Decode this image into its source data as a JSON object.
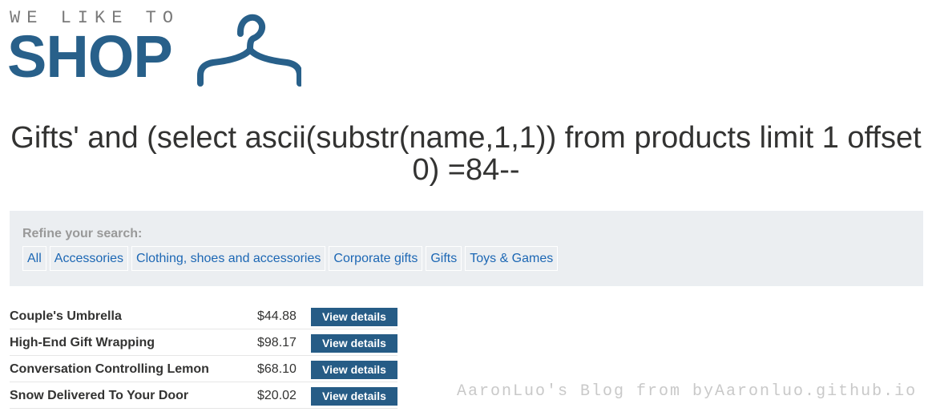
{
  "logo": {
    "tagline": "WE LIKE TO",
    "word": "SHOP",
    "icon": "hanger-icon",
    "color": "#28608a"
  },
  "page_title": "Gifts' and (select ascii(substr(name,1,1)) from products limit 1 offset 0) =84--",
  "filters": {
    "heading": "Refine your search:",
    "items": [
      {
        "label": "All"
      },
      {
        "label": "Accessories"
      },
      {
        "label": "Clothing, shoes and accessories"
      },
      {
        "label": "Corporate gifts"
      },
      {
        "label": "Gifts"
      },
      {
        "label": "Toys & Games"
      }
    ]
  },
  "products": [
    {
      "name": "Couple's Umbrella",
      "price": "$44.88",
      "button": "View details"
    },
    {
      "name": "High-End Gift Wrapping",
      "price": "$98.17",
      "button": "View details"
    },
    {
      "name": "Conversation Controlling Lemon",
      "price": "$68.10",
      "button": "View details"
    },
    {
      "name": "Snow Delivered To Your Door",
      "price": "$20.02",
      "button": "View details"
    }
  ],
  "watermark": "AaronLuo's Blog from byAaronluo.github.io",
  "colors": {
    "accent": "#28608a",
    "button": "#265c86",
    "link": "#1c67b4",
    "panel": "#ebeef1"
  }
}
